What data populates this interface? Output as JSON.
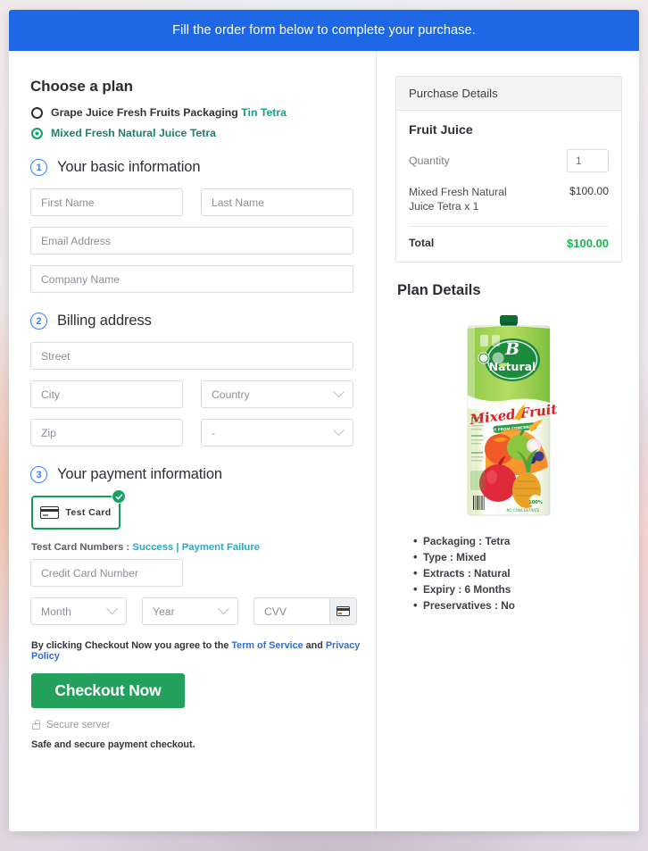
{
  "banner": {
    "text": "Fill the order form below to complete your purchase."
  },
  "plan": {
    "heading": "Choose a plan",
    "options": [
      {
        "label": "Grape Juice Fresh Fruits Packaging",
        "accent": "Tin Tetra",
        "selected": false
      },
      {
        "label": "Mixed Fresh Natural Juice Tetra",
        "accent": "",
        "selected": true
      }
    ]
  },
  "steps": {
    "basic": {
      "number": "1",
      "title": "Your basic information"
    },
    "billing": {
      "number": "2",
      "title": "Billing address"
    },
    "payment": {
      "number": "3",
      "title": "Your payment information"
    }
  },
  "fields": {
    "first_name": "First Name",
    "last_name": "Last Name",
    "email": "Email Address",
    "company": "Company Name",
    "street": "Street",
    "city": "City",
    "country": "Country",
    "zip": "Zip",
    "state": "-",
    "credit_card": "Credit Card Number",
    "month": "Month",
    "year": "Year",
    "cvv": "CVV"
  },
  "payment": {
    "test_card_label": "Test Card",
    "note_prefix": "Test Card Numbers : ",
    "link_success": "Success",
    "separator": " | ",
    "link_failure": "Payment Failure"
  },
  "terms": {
    "prefix": "By clicking Checkout Now you agree to the ",
    "link_terms": "Term of Service",
    "middle": " and ",
    "link_privacy": "Privacy Policy"
  },
  "actions": {
    "checkout_label": "Checkout Now",
    "secure_server": "Secure server",
    "safe_note": "Safe and secure payment checkout."
  },
  "purchase": {
    "header": "Purchase Details",
    "product": "Fruit Juice",
    "quantity_label": "Quantity",
    "quantity_value": "1",
    "line_item_name": "Mixed Fresh Natural Juice Tetra x 1",
    "line_item_amount": "$100.00",
    "total_label": "Total",
    "total_amount": "$100.00"
  },
  "plan_details": {
    "title": "Plan Details",
    "product_brand": "B Natural",
    "product_variant": "Mixed Fruit",
    "product_tagline": "NOT FROM CONCENTRATE",
    "features": [
      "Packaging : Tetra",
      "Type : Mixed",
      "Extracts : Natural",
      "Expiry : 6 Months",
      "Preservatives : No"
    ]
  },
  "colors": {
    "banner_blue": "#1f68e5",
    "accent_green": "#22a05c",
    "total_green": "#1fb255",
    "link_blue": "#2f6fd0",
    "link_teal": "#29a8c4",
    "step_blue": "#3c7ff0"
  }
}
